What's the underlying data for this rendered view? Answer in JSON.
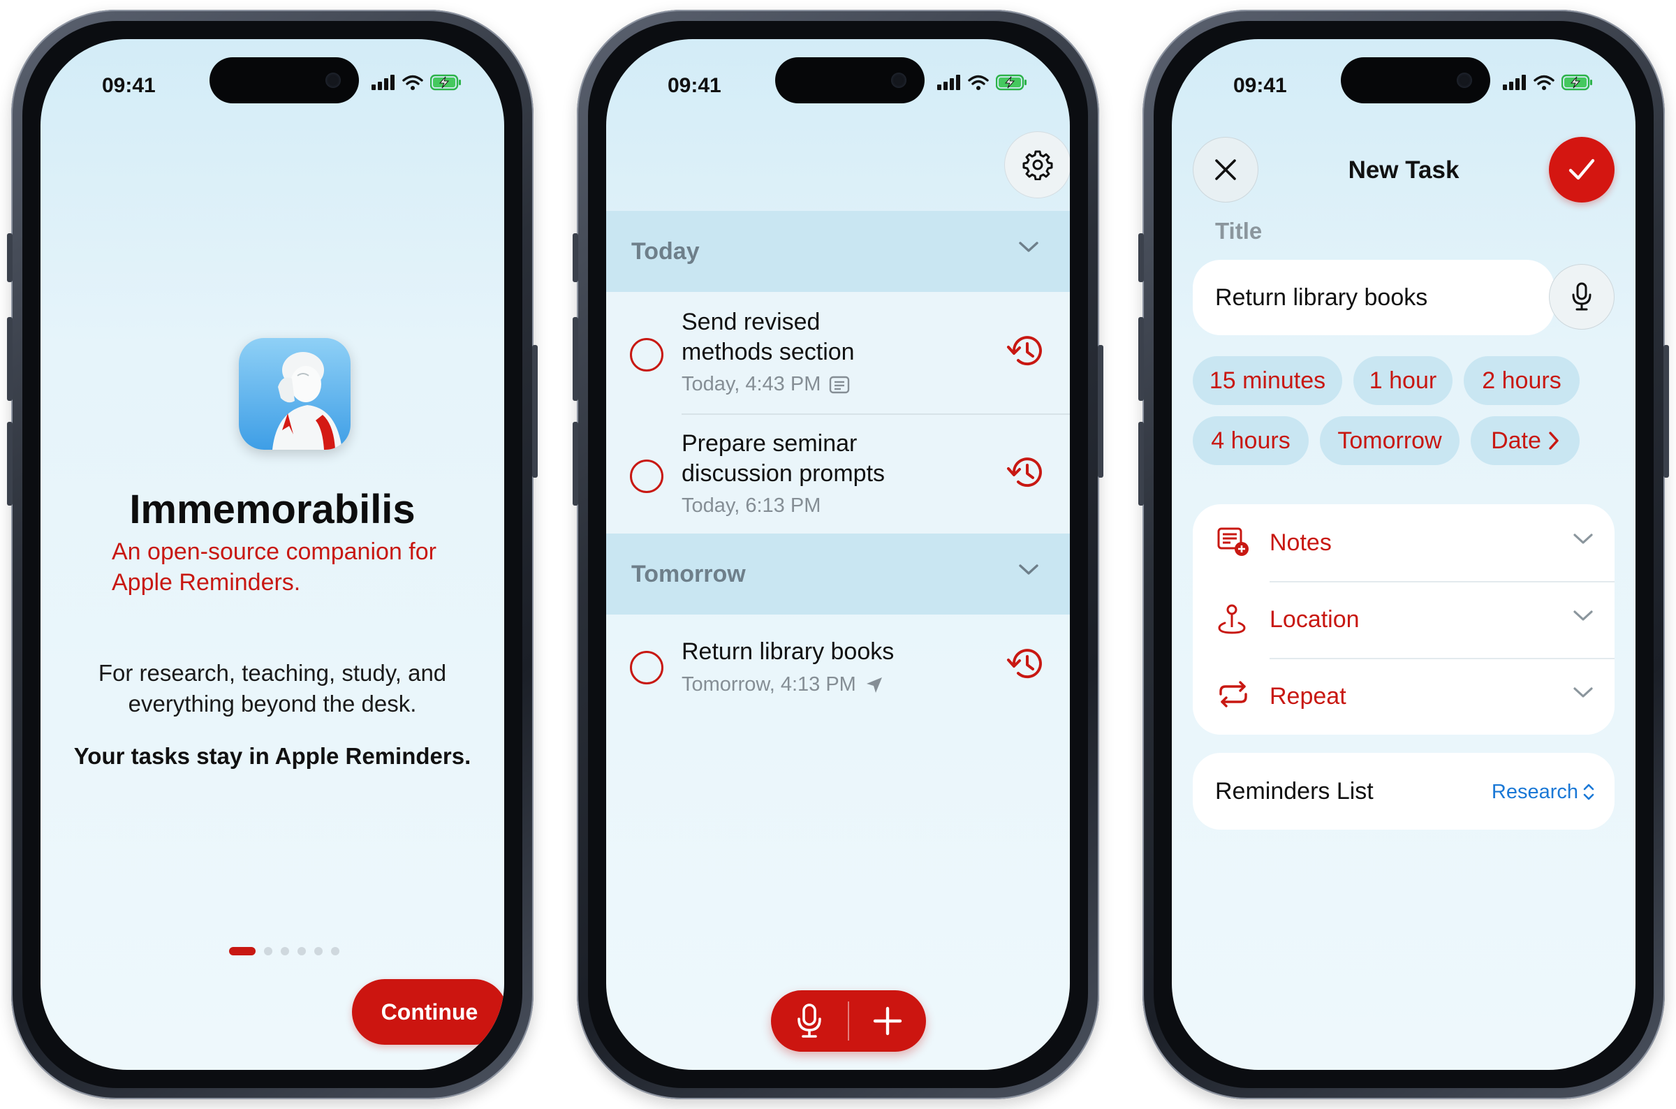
{
  "status_bar": {
    "time": "09:41"
  },
  "onboarding": {
    "app_name": "Immemorabilis",
    "tagline": "An open-source companion for Apple Reminders.",
    "description": "For research, teaching, study, and everything beyond the desk.",
    "emphasis": "Your tasks stay in Apple Reminders.",
    "page_count": 6,
    "active_page": 1,
    "continue_label": "Continue"
  },
  "task_list": {
    "sections": [
      {
        "title": "Today",
        "tasks": [
          {
            "title_line1": "Send revised",
            "title_line2": "methods section",
            "meta": "Today, 4:43 PM",
            "meta_icon": "notes-icon"
          },
          {
            "title_line1": "Prepare seminar",
            "title_line2": "discussion prompts",
            "meta": "Today, 6:13 PM",
            "meta_icon": ""
          }
        ]
      },
      {
        "title": "Tomorrow",
        "tasks": [
          {
            "title_line1": "Return library books",
            "meta": "Tomorrow, 4:13 PM",
            "meta_icon": "location-arrow-icon"
          }
        ]
      }
    ]
  },
  "new_task": {
    "header": "New Task",
    "title_label": "Title",
    "title_value": "Return library books",
    "chips": [
      "15 minutes",
      "1 hour",
      "2 hours",
      "4 hours",
      "Tomorrow",
      "Date"
    ],
    "options": [
      {
        "label": "Notes",
        "icon": "notes-add-icon"
      },
      {
        "label": "Location",
        "icon": "location-pin-icon"
      },
      {
        "label": "Repeat",
        "icon": "repeat-icon"
      }
    ],
    "list_label": "Reminders List",
    "list_value": "Research"
  },
  "colors": {
    "accent": "#cc1510",
    "section_bg": "#c9e6f2",
    "link": "#1a78d6"
  }
}
